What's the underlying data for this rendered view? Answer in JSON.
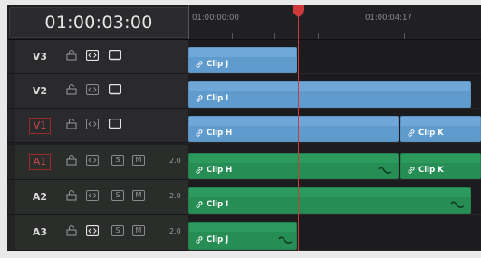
{
  "timecode": "01:00:03:00",
  "ruler": {
    "labels": [
      "01:00:00:00",
      "01:00:04:17"
    ]
  },
  "tracks": [
    {
      "name": "V3",
      "kind": "video",
      "active": false
    },
    {
      "name": "V2",
      "kind": "video",
      "active": false
    },
    {
      "name": "V1",
      "kind": "video",
      "active": true
    },
    {
      "name": "A1",
      "kind": "audio",
      "active": true,
      "channels": "2.0"
    },
    {
      "name": "A2",
      "kind": "audio",
      "active": false,
      "channels": "2.0"
    },
    {
      "name": "A3",
      "kind": "audio",
      "active": false,
      "channels": "2.0"
    }
  ],
  "audio_buttons": {
    "solo": "S",
    "mute": "M"
  },
  "clips": {
    "v3": "Clip J",
    "v2": "Clip I",
    "v1a": "Clip H",
    "v1b": "Clip K",
    "a1a": "Clip H",
    "a1b": "Clip K",
    "a2": "Clip I",
    "a3": "Clip J"
  },
  "icons": {
    "lock": "lock-icon",
    "auto_select": "auto-select-icon",
    "monitor": "monitor-icon",
    "link": "link-icon",
    "waveform": "waveform-icon"
  },
  "colors": {
    "video_clip": "#6fa8d8",
    "audio_clip": "#2c9a5d",
    "playhead": "#d0393b",
    "active_track_outline": "#9c2a2a"
  }
}
